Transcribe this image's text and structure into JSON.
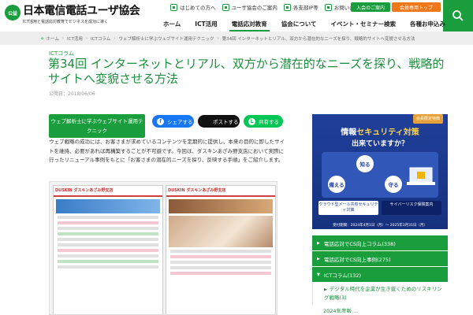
{
  "header": {
    "logo_mark": "公益社団法人",
    "logo_name": "日本電信電話ユーザ協会",
    "logo_sub": "ICT活用と電話応対教育でビジネスを成功に導く",
    "util_links": [
      "はじめての方へ",
      "ユーザ協会のご案内",
      "各支部IP等",
      "お問い合わせ"
    ],
    "join_label": "入会のご案内",
    "member_label": "会員専用トップ",
    "nav": [
      "ホーム",
      "ICT活用",
      "電話応対教育",
      "協会について",
      "イベント・セミナー検索",
      "各種お申込み"
    ],
    "active_nav": "電話応対教育"
  },
  "breadcrumb": [
    "ホーム",
    "ICT活用",
    "ICTコラム",
    "ウェブ解析士に学ぶウェブサイト運用テクニック",
    "第34回 インターネットとリアル、双方から潜在的なニーズを探り、戦略的サイトへ変貌させる方法"
  ],
  "article": {
    "category": "ICTコラム",
    "title": "第34回 インターネットとリアル、双方から潜在的なニーズを探り、戦略的サイトへ変貌させる方法",
    "published": "公開日：2018/06/06",
    "series_tag": "ウェブ解析士に学ぶウェブサイト運用テクニック",
    "share": {
      "facebook": "シェアする",
      "x": "ポストする",
      "line": "共有する"
    },
    "body": "ウェブ戦略の成功には、お客さまが求めているコンテンツを定期的に提供し、本来の目的に即したサイトを維持、必要があれば再構築することが不可避です。今回は、ダスキンあざみ野支店において実際に行ったリニューアル事例をもとに「お客さまの潜在的ニーズを探り、反映する手順」をご紹介します。",
    "image": {
      "left_header": "DUSKIN ダスキンあざみ野支店",
      "right_header": "DUSKIN ダスキンあざみ野支店"
    }
  },
  "sidebar": {
    "ad": {
      "tag": "会員限定特典",
      "title_pre": "情報",
      "title_highlight": "セキュリティ対策",
      "subtitle": "出来ていますか？",
      "circles": [
        "知る",
        "備える",
        "守る"
      ],
      "box_left": "クラウド型メール共有セキュリティ対策",
      "box_right": "サイバーリスク保険案内",
      "footnote": "受付期間：2024年4月1日（月）～ 2025年3月31日（月）"
    },
    "list": [
      {
        "label": "電話応対でCS向上コラム(338)"
      },
      {
        "label": "電話応対でCS向上事例(275)"
      },
      {
        "label": "ICTコラム(132)"
      }
    ],
    "sub_items": [
      "デジタル時代を企業が生き抜くためのリスキリング戦略(3)",
      "2024年度版 ..."
    ]
  }
}
